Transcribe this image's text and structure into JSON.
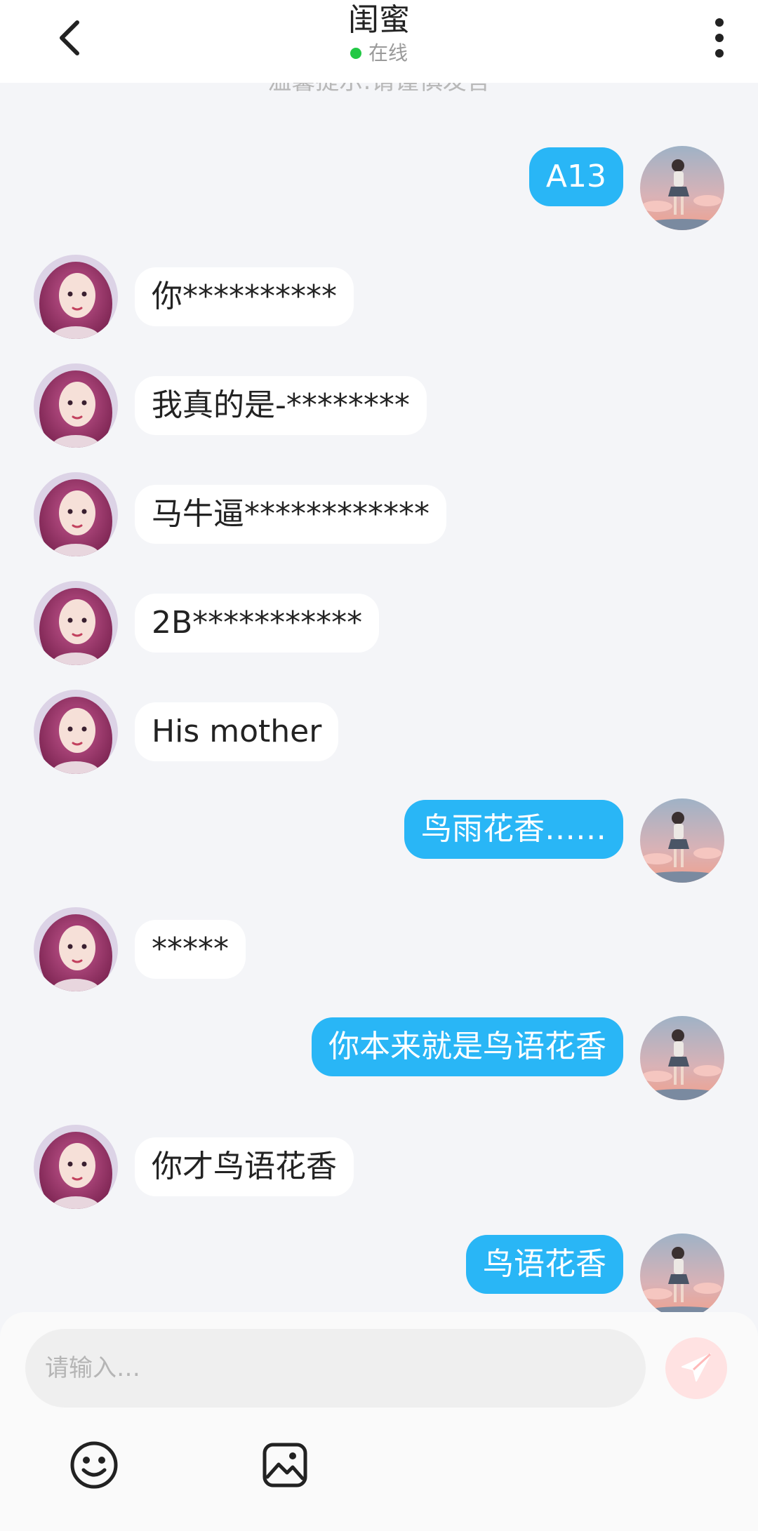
{
  "header": {
    "title": "闺蜜",
    "status": "在线",
    "status_color": "#22c845",
    "back_icon": "chevron-left-icon",
    "menu_icon": "more-vertical-icon"
  },
  "notice": "温馨提示:请谨慎发言",
  "messages": [
    {
      "side": "right",
      "text": "A13"
    },
    {
      "side": "left",
      "text": "你**********"
    },
    {
      "side": "left",
      "text": "我真的是-********"
    },
    {
      "side": "left",
      "text": "马牛逼************"
    },
    {
      "side": "left",
      "text": "2B***********"
    },
    {
      "side": "left",
      "text": "His mother"
    },
    {
      "side": "right",
      "text": "鸟雨花香……"
    },
    {
      "side": "left",
      "text": "*****"
    },
    {
      "side": "right",
      "text": "你本来就是鸟语花香"
    },
    {
      "side": "left",
      "text": "你才鸟语花香"
    },
    {
      "side": "right",
      "text": "鸟语花香"
    }
  ],
  "composer": {
    "placeholder": "请输入…",
    "send_icon": "paper-plane-icon",
    "tools": [
      "smiley-icon",
      "image-icon"
    ]
  },
  "colors": {
    "outgoing_bubble": "#29b6f6",
    "incoming_bubble": "#ffffff",
    "background": "#f4f5f8"
  }
}
